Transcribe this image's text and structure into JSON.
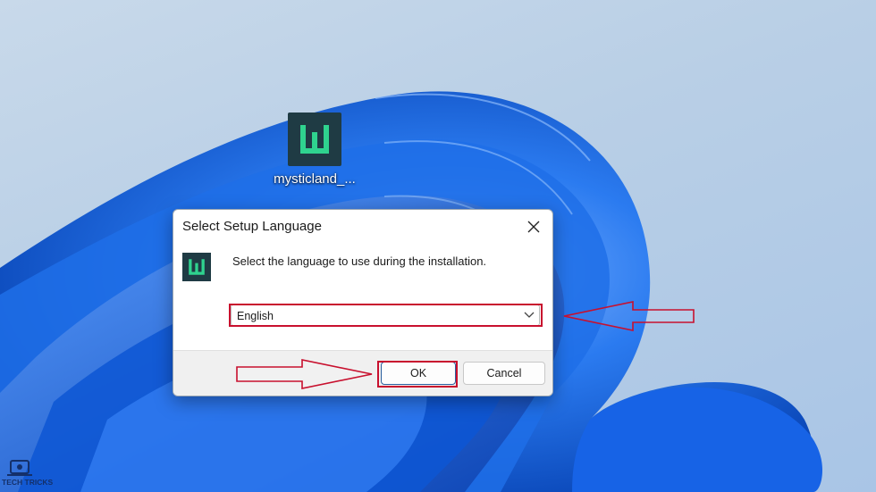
{
  "desktop": {
    "icon_label": "mysticland_..."
  },
  "dialog": {
    "title": "Select Setup Language",
    "message": "Select the language to use during the installation.",
    "language_select": {
      "selected": "English"
    },
    "ok_label": "OK",
    "cancel_label": "Cancel"
  },
  "watermark": {
    "brand": "TECH TRICKS"
  },
  "colors": {
    "annotation_red": "#c8102e",
    "app_icon_bg": "#1f3b44",
    "app_icon_accent": "#2fd38f",
    "wallpaper_blue": "#0a5cd6"
  }
}
